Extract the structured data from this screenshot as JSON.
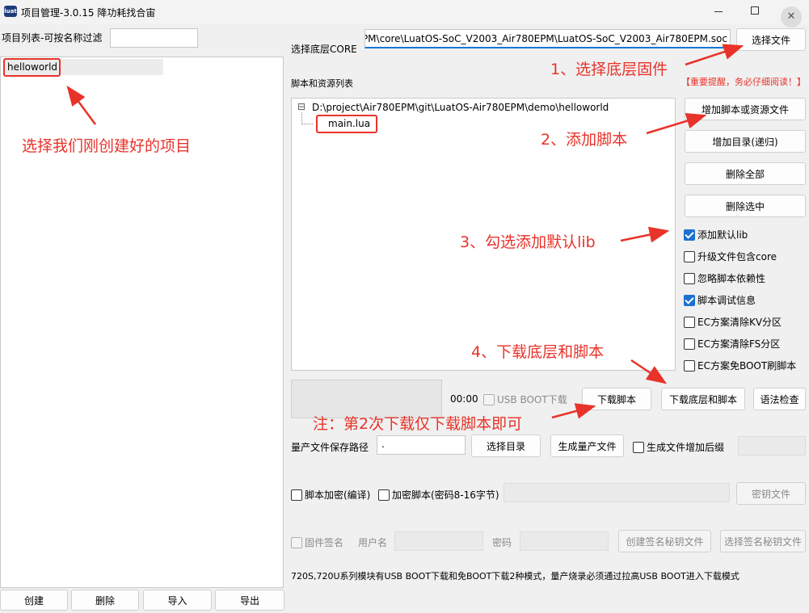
{
  "window": {
    "title": "项目管理-3.0.15 降功耗找合宙"
  },
  "left_panel": {
    "filter_label": "项目列表-可按名称过滤",
    "filter_value": "",
    "projects": [
      "helloworld"
    ],
    "buttons": {
      "create": "创建",
      "delete": "删除",
      "import": "导入",
      "export": "导出"
    }
  },
  "core": {
    "label": "选择底层CORE",
    "path": "EPM\\core\\LuatOS-SoC_V2003_Air780EPM\\LuatOS-SoC_V2003_Air780EPM.soc",
    "choose_button": "选择文件"
  },
  "scripts": {
    "label": "脚本和资源列表",
    "warning": "【重要提醒，务必仔细阅读！】",
    "tree_root": "D:\\project\\Air780EPM\\git\\LuatOS-Air780EPM\\demo\\helloworld",
    "tree_child": "main.lua",
    "tree_toggle": "⊟",
    "buttons": {
      "add_script": "增加脚本或资源文件",
      "add_dir": "增加目录(递归)",
      "delete_all": "删除全部",
      "delete_selected": "删除选中"
    }
  },
  "options": {
    "add_default_lib": "添加默认lib",
    "upgrade_with_core": "升级文件包含core",
    "ignore_deps": "忽略脚本依赖性",
    "debug_info": "脚本调试信息",
    "ec_clear_kv": "EC方案清除KV分区",
    "ec_clear_fs": "EC方案清除FS分区",
    "ec_no_boot": "EC方案免BOOT刷脚本"
  },
  "download": {
    "time": "00:00",
    "usb_boot": "USB BOOT下载",
    "download_script": "下载脚本",
    "download_core_script": "下载底层和脚本",
    "syntax_check": "语法检查"
  },
  "mass_production": {
    "path_label": "量产文件保存路径",
    "path_value": ".",
    "choose_dir": "选择目录",
    "generate": "生成量产文件",
    "suffix": "生成文件增加后缀"
  },
  "encrypt": {
    "compile_encrypt": "脚本加密(编译)",
    "password_encrypt": "加密脚本(密码8-16字节)",
    "key_file": "密钥文件"
  },
  "sign": {
    "firmware_sign": "固件签名",
    "username": "用户名",
    "password": "密码",
    "create_key": "创建签名秘钥文件",
    "choose_key": "选择签名秘钥文件"
  },
  "footer_note": "720S,720U系列模块有USB BOOT下载和免BOOT下载2种模式，量产烧录必须通过拉高USB BOOT进入下载模式",
  "annotations": {
    "step1": "1、选择底层固件",
    "step2": "2、添加脚本",
    "step3": "3、勾选添加默认lib",
    "step4": "4、下载底层和脚本",
    "select_project": "选择我们刚创建好的项目",
    "note": "注：第2次下载仅下载脚本即可"
  },
  "colors": {
    "annotation": "#e8332a",
    "warning": "#e8332a",
    "checkbox_on": "#1f6fd0",
    "selection": "#0078d7"
  }
}
